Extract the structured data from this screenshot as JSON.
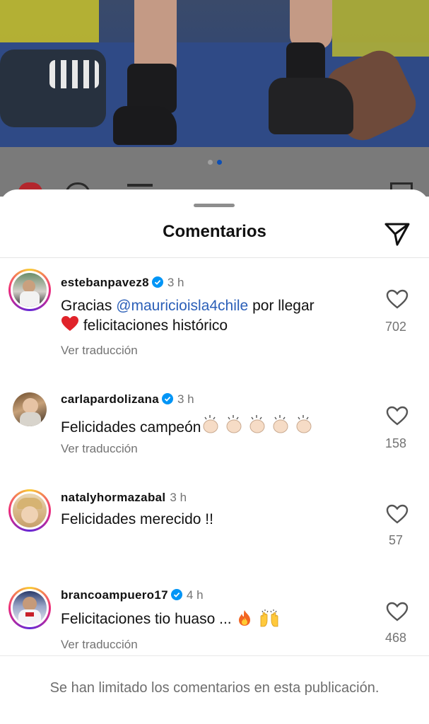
{
  "sheet": {
    "title": "Comentarios"
  },
  "comments": [
    {
      "username": "estebanpavez8",
      "verified": true,
      "time": "3 h",
      "text_before": "Gracias ",
      "mention": "@mauricioisla4chile",
      "text_after": " por llegar",
      "line2": "felicitaciones histórico",
      "translate": "Ver traducción",
      "likes": "702"
    },
    {
      "username": "carlapardolizana",
      "verified": true,
      "time": "3 h",
      "text": "Felicidades campeón",
      "translate": "Ver traducción",
      "likes": "158"
    },
    {
      "username": "natalyhormazabal",
      "verified": false,
      "time": "3 h",
      "text": "Felicidades merecido !!",
      "likes": "57"
    },
    {
      "username": "brancoampuero17",
      "verified": true,
      "time": "4 h",
      "text": "Felicitaciones tio huaso ...",
      "translate": "Ver traducción",
      "likes": "468"
    }
  ],
  "footer": {
    "notice": "Se han limitado los comentarios en esta publicación."
  },
  "colors": {
    "mention": "#2b5fb8",
    "verified": "#0095f6",
    "muted": "#737373"
  }
}
